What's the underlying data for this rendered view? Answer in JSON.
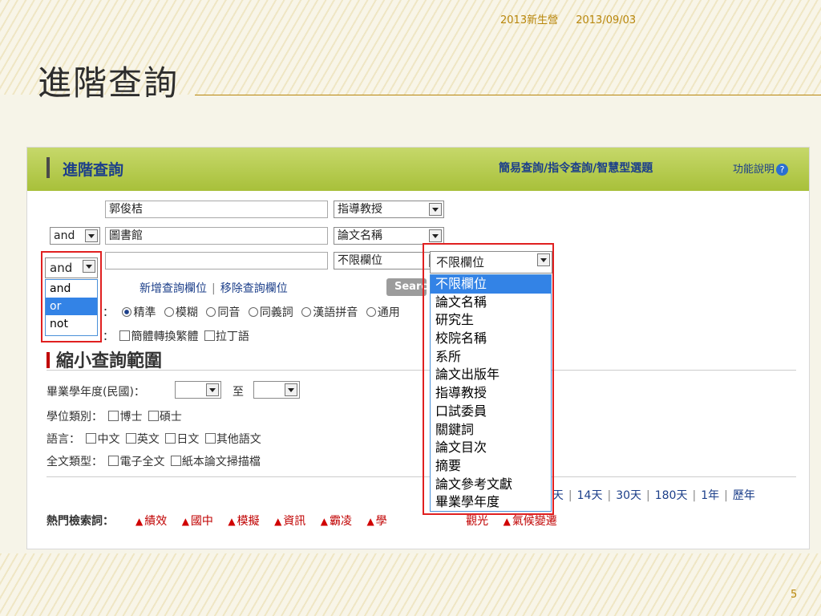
{
  "slide": {
    "header_event": "2013新生營",
    "header_date": "2013/09/03",
    "title": "進階查詢",
    "page_number": "5"
  },
  "app": {
    "panel_title": "進階查詢",
    "top_links": "簡易查詢/指令查詢/智慧型選題",
    "help_label": "功能說明",
    "help_icon": "?"
  },
  "rows": [
    {
      "value": "郭俊桔",
      "field": "指導教授"
    },
    {
      "operator": "and",
      "value": "圖書館",
      "field": "論文名稱"
    },
    {
      "operator": "and",
      "value": "",
      "field": "不限欄位"
    }
  ],
  "row_links": {
    "add": "新增查詢欄位",
    "separator": "|",
    "remove": "移除查詢欄位"
  },
  "search_button": "Search",
  "match_options": {
    "prefix": "：",
    "options": [
      "精準",
      "模糊",
      "同音",
      "同義詞",
      "漢語拼音",
      "通用"
    ],
    "selected": 0
  },
  "convert_options": {
    "prefix": "：",
    "options": [
      "簡體轉換繁體",
      "拉丁語"
    ]
  },
  "narrow": {
    "title": "縮小查詢範圍",
    "year_label": "畢業學年度(民國)：",
    "year_to": "至",
    "degree_label": "學位類別：",
    "degree_options": [
      "博士",
      "碩士"
    ],
    "lang_label": "語言：",
    "lang_options": [
      "中文",
      "英文",
      "日文",
      "其他語文"
    ],
    "fulltext_label": "全文類型：",
    "fulltext_options": [
      "電子全文",
      "紙本論文掃描檔"
    ]
  },
  "time_links": [
    "7天",
    "14天",
    "30天",
    "180天",
    "1年",
    "歷年"
  ],
  "hot_keywords": {
    "label": "熱門檢索詞：",
    "items": [
      "績效",
      "國中",
      "模擬",
      "資訊",
      "霸凌",
      "學",
      "",
      "觀光",
      "氣候變遷"
    ]
  },
  "operator_dropdown": {
    "current": "and",
    "options": [
      "and",
      "or",
      "not"
    ],
    "highlighted": 1
  },
  "field_dropdown": {
    "current": "不限欄位",
    "options": [
      "不限欄位",
      "論文名稱",
      "研究生",
      "校院名稱",
      "系所",
      "論文出版年",
      "指導教授",
      "口試委員",
      "關鍵詞",
      "論文目次",
      "摘要",
      "論文參考文獻",
      "畢業學年度"
    ],
    "highlighted": 0
  },
  "colors": {
    "bar": "#a8c03a",
    "link": "#1c3f8a",
    "accent_red": "#e02020",
    "highlight": "#3383e6",
    "slide_gold": "#b8860b"
  }
}
